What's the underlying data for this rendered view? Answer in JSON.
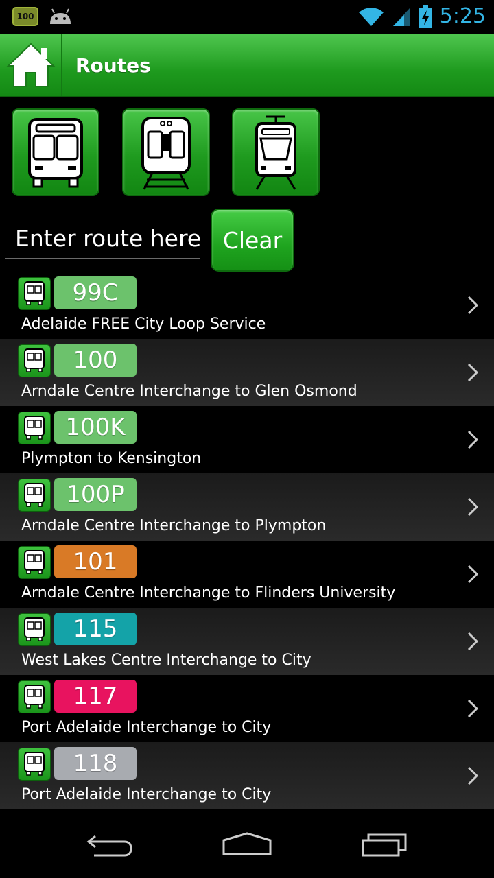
{
  "status_bar": {
    "battery_badge": "100",
    "time": "5:25"
  },
  "action_bar": {
    "title": "Routes"
  },
  "modes": [
    {
      "name": "bus-mode-icon"
    },
    {
      "name": "train-mode-icon"
    },
    {
      "name": "tram-mode-icon"
    }
  ],
  "search": {
    "placeholder": "Enter route here",
    "value": "",
    "clear_label": "Clear"
  },
  "routes": [
    {
      "number": "99C",
      "desc": "Adelaide FREE City Loop Service",
      "color": "#6cc26c"
    },
    {
      "number": "100",
      "desc": "Arndale Centre Interchange to Glen Osmond",
      "color": "#6cc26c"
    },
    {
      "number": "100K",
      "desc": "Plympton to Kensington",
      "color": "#6cc26c"
    },
    {
      "number": "100P",
      "desc": "Arndale Centre Interchange to Plympton",
      "color": "#6cc26c"
    },
    {
      "number": "101",
      "desc": "Arndale Centre Interchange to Flinders University",
      "color": "#d97a26"
    },
    {
      "number": "115",
      "desc": "West Lakes Centre Interchange to City",
      "color": "#14a3a8"
    },
    {
      "number": "117",
      "desc": "Port Adelaide Interchange to City",
      "color": "#e8135f"
    },
    {
      "number": "118",
      "desc": "Port Adelaide Interchange to City",
      "color": "#a8abb0"
    }
  ]
}
